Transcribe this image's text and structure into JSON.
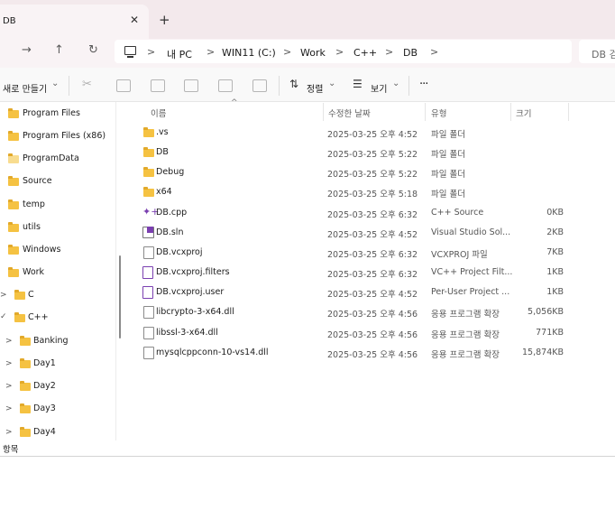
{
  "window": {
    "tab_title": "DB",
    "close_glyph": "✕",
    "new_tab_glyph": "+"
  },
  "nav": {
    "back_glyph": "→",
    "up_glyph": "↑",
    "refresh_glyph": "↻",
    "breadcrumbs": [
      "내 PC",
      "WIN11 (C:)",
      "Work",
      "C++",
      "DB"
    ],
    "chevron_glyph": ">",
    "search_placeholder": "DB 검"
  },
  "toolbar": {
    "new_label": "새로 만들기",
    "sort_label": "정렬",
    "view_label": "보기",
    "more_glyph": "···",
    "dropdown_glyph": "⌄"
  },
  "sidebar": {
    "items": [
      {
        "label": "Program Files"
      },
      {
        "label": "Program Files (x86)"
      },
      {
        "label": "ProgramData"
      },
      {
        "label": "Source"
      },
      {
        "label": "temp"
      },
      {
        "label": "utils"
      },
      {
        "label": "Windows"
      },
      {
        "label": "Work"
      },
      {
        "label": "C"
      },
      {
        "label": "C++"
      },
      {
        "label": "Banking"
      },
      {
        "label": "Day1"
      },
      {
        "label": "Day2"
      },
      {
        "label": "Day3"
      },
      {
        "label": "Day4"
      }
    ]
  },
  "columns": {
    "name": "이름",
    "date": "수정한 날짜",
    "type": "유형",
    "size": "크기",
    "sort_glyph": "^"
  },
  "files": [
    {
      "name": ".vs",
      "date": "2025-03-25 오후 4:52",
      "type": "파일 폴더",
      "size": "",
      "kind": "folder"
    },
    {
      "name": "DB",
      "date": "2025-03-25 오후 5:22",
      "type": "파일 폴더",
      "size": "",
      "kind": "folder"
    },
    {
      "name": "Debug",
      "date": "2025-03-25 오후 5:22",
      "type": "파일 폴더",
      "size": "",
      "kind": "folder"
    },
    {
      "name": "x64",
      "date": "2025-03-25 오후 5:18",
      "type": "파일 폴더",
      "size": "",
      "kind": "folder"
    },
    {
      "name": "DB.cpp",
      "date": "2025-03-25 오후 6:32",
      "type": "C++ Source",
      "size": "0KB",
      "kind": "cpp"
    },
    {
      "name": "DB.sln",
      "date": "2025-03-25 오후 4:52",
      "type": "Visual Studio Sol...",
      "size": "2KB",
      "kind": "sln"
    },
    {
      "name": "DB.vcxproj",
      "date": "2025-03-25 오후 6:32",
      "type": "VCXPROJ 파일",
      "size": "7KB",
      "kind": "file"
    },
    {
      "name": "DB.vcxproj.filters",
      "date": "2025-03-25 오후 6:32",
      "type": "VC++ Project Filt...",
      "size": "1KB",
      "kind": "filters"
    },
    {
      "name": "DB.vcxproj.user",
      "date": "2025-03-25 오후 4:52",
      "type": "Per-User Project ...",
      "size": "1KB",
      "kind": "user"
    },
    {
      "name": "libcrypto-3-x64.dll",
      "date": "2025-03-25 오후 4:56",
      "type": "응용 프로그램 확장",
      "size": "5,056KB",
      "kind": "dll"
    },
    {
      "name": "libssl-3-x64.dll",
      "date": "2025-03-25 오후 4:56",
      "type": "응용 프로그램 확장",
      "size": "771KB",
      "kind": "dll"
    },
    {
      "name": "mysqlcppconn-10-vs14.dll",
      "date": "2025-03-25 오후 4:56",
      "type": "응용 프로그램 확장",
      "size": "15,874KB",
      "kind": "dll"
    }
  ],
  "status": {
    "text": "항목"
  },
  "colors": {
    "folder": "#f5c242",
    "accent": "#7a3fb0",
    "tabstrip": "#f3e9ec"
  }
}
